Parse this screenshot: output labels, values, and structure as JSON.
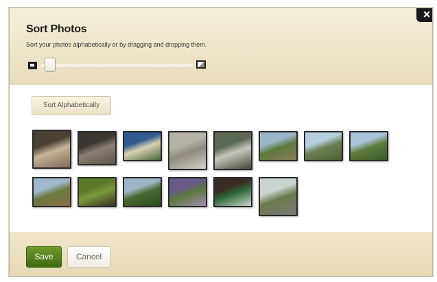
{
  "dialog": {
    "title": "Sort Photos",
    "subtitle": "Sort your photos alphabetically or by dragging and dropping them.",
    "close_label": "×",
    "zoom_slider_value": 0.05,
    "sort_button_label": "Sort Alphabetically",
    "save_label": "Save",
    "cancel_label": "Cancel"
  },
  "photos": [
    {
      "name": "victorian-houses-photo",
      "colors": [
        "#4a4034",
        "#c4b59a",
        "#7d6a55"
      ]
    },
    {
      "name": "dark-victorian-house-photo",
      "colors": [
        "#3b3632",
        "#8c7f72",
        "#5c544c"
      ]
    },
    {
      "name": "street-house-photo",
      "colors": [
        "#2f5b8f",
        "#d9cfb6",
        "#4a6a3a"
      ]
    },
    {
      "name": "stone-statue-photo",
      "colors": [
        "#b7b2a8",
        "#8f8a80",
        "#d6d1c6"
      ]
    },
    {
      "name": "gargoyle-statue-photo",
      "colors": [
        "#5a6a52",
        "#c9c6bd",
        "#3e4a36"
      ]
    },
    {
      "name": "circular-ruin-photo",
      "colors": [
        "#9ab6c9",
        "#5d7a3d",
        "#8d7a58"
      ]
    },
    {
      "name": "coastal-cliff-photo",
      "colors": [
        "#b8cfdf",
        "#6b7f55",
        "#4d6233"
      ]
    },
    {
      "name": "coastal-hills-photo",
      "colors": [
        "#a8c2d6",
        "#5e7a3a",
        "#3f5a2a"
      ]
    },
    {
      "name": "hillside-path-photo",
      "colors": [
        "#9fb8cc",
        "#6b7a3f",
        "#8a6e4a"
      ]
    },
    {
      "name": "turkey-in-grass-photo",
      "colors": [
        "#5a7a2a",
        "#7a9a3a",
        "#3a2e22"
      ]
    },
    {
      "name": "green-valley-photo",
      "colors": [
        "#9fb5c5",
        "#4a6630",
        "#2f4a20"
      ]
    },
    {
      "name": "purple-flowers-photo",
      "colors": [
        "#6a5a8a",
        "#5a7a3a",
        "#a58ab5"
      ]
    },
    {
      "name": "trail-sign-photo",
      "colors": [
        "#3a2e24",
        "#2f6a3a",
        "#c9d6cf"
      ]
    },
    {
      "name": "wooden-walkway-photo",
      "colors": [
        "#c9d3cf",
        "#6a7a4a",
        "#7a7a78"
      ]
    }
  ]
}
